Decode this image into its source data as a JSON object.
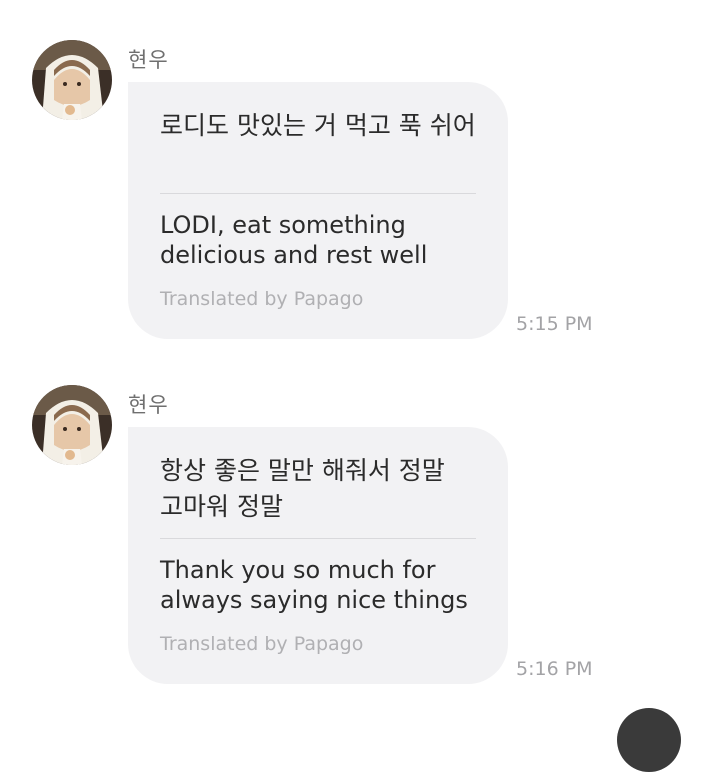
{
  "messages": [
    {
      "sender": "현우",
      "original": "로디도 맛있는 거 먹고 푹 쉬어",
      "translation": "LODI, eat something delicious and rest well",
      "credit": "Translated by Papago",
      "time": "5:15 PM"
    },
    {
      "sender": "현우",
      "original": "항상 좋은 말만 해줘서 정말 고마워 정말",
      "translation": "Thank you so much for always saying nice things",
      "credit": "Translated by Papago",
      "time": "5:16 PM"
    }
  ],
  "icons": {
    "avatar": "profile-photo"
  }
}
